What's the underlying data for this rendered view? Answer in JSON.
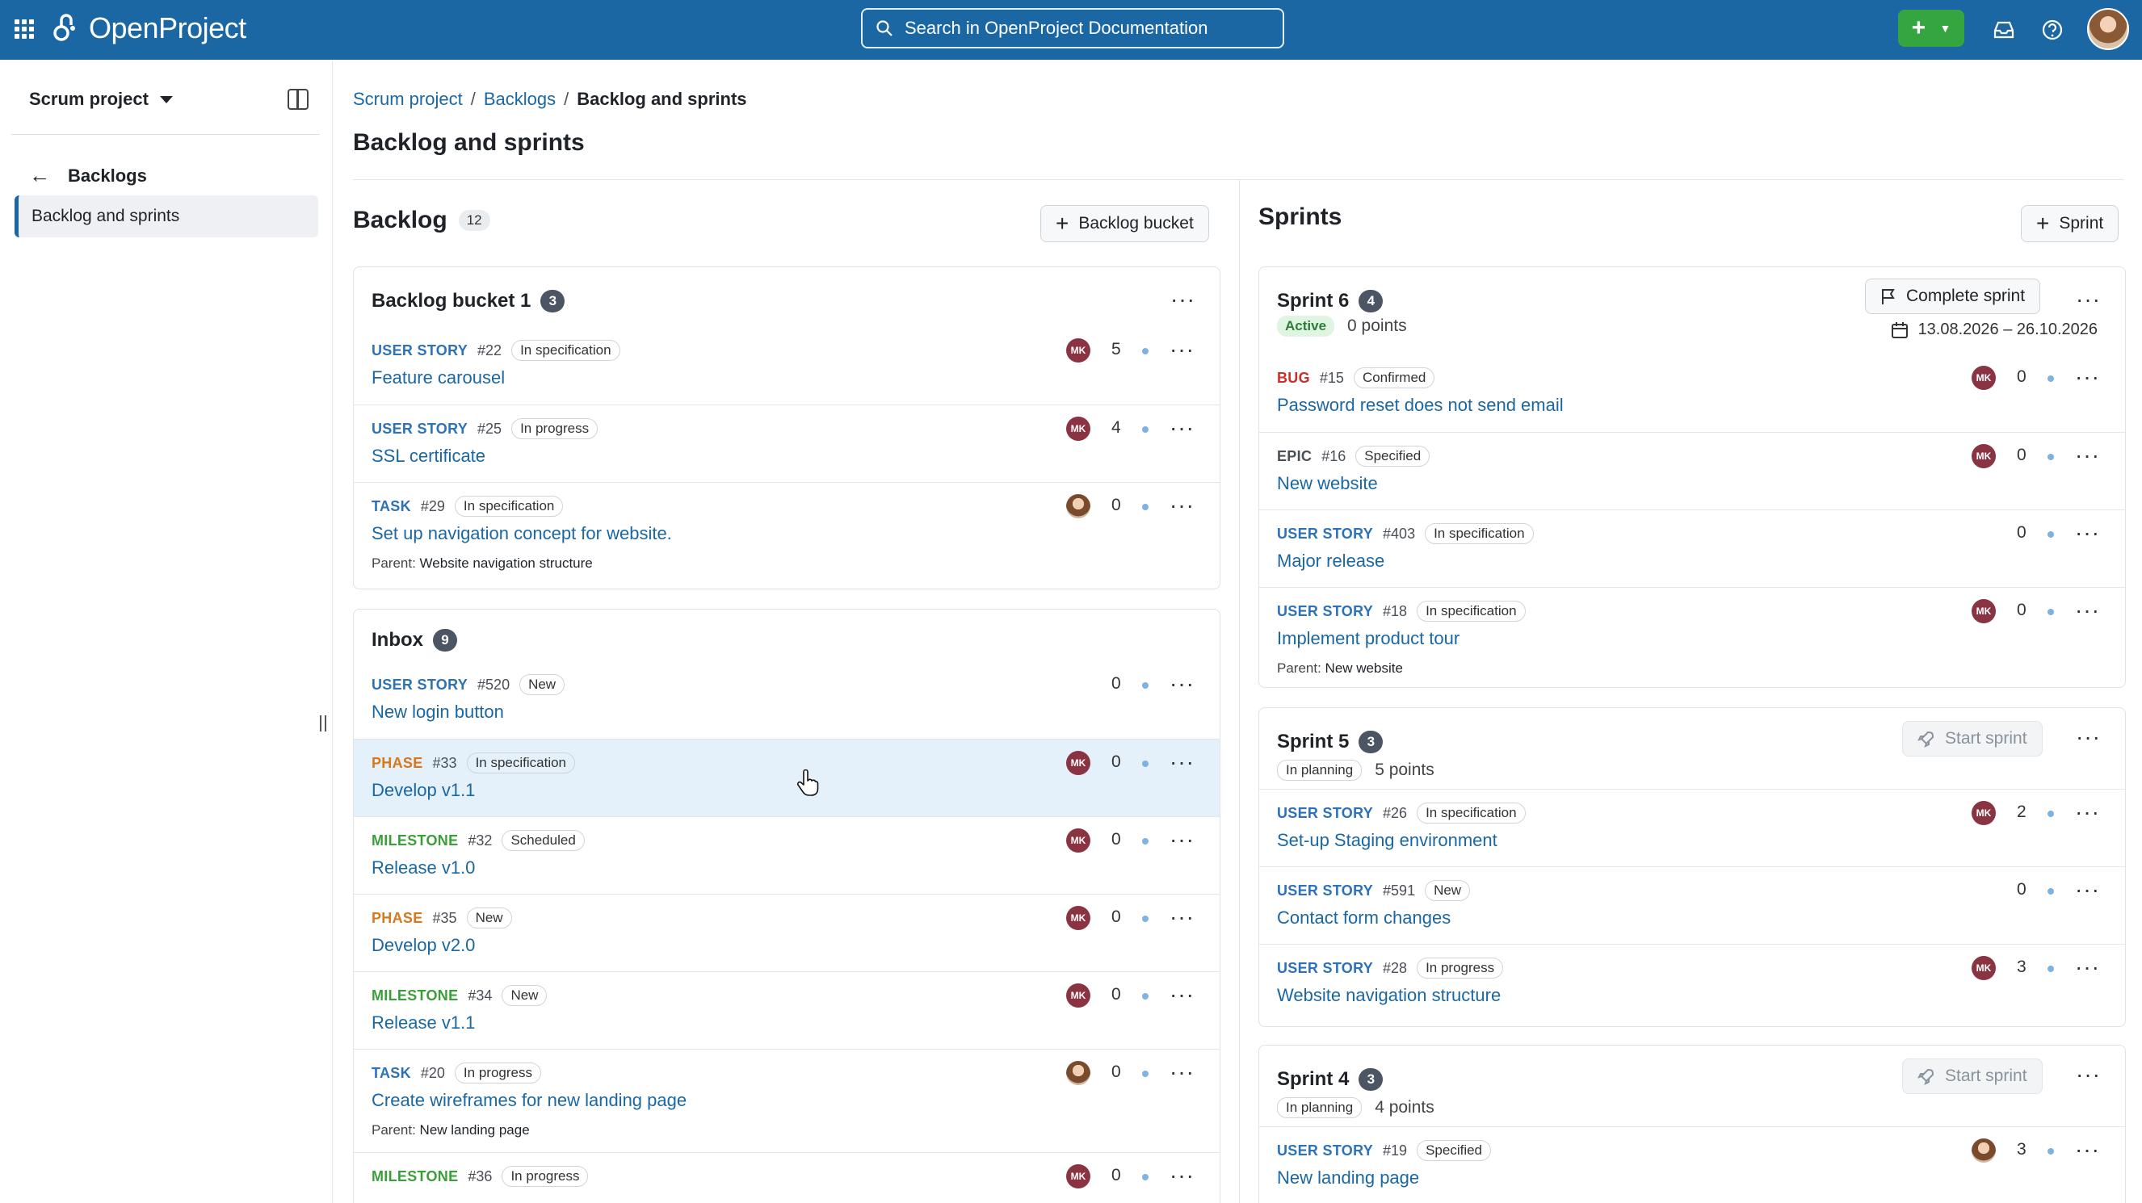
{
  "header": {
    "logo_text": "OpenProject",
    "search_placeholder": "Search in OpenProject Documentation",
    "plus_label": "+",
    "icons": [
      "grid-icon",
      "logo-icon",
      "search-icon",
      "plus-icon",
      "chevron-down-icon",
      "inbox-icon",
      "help-icon",
      "avatar"
    ]
  },
  "sidebar": {
    "project": "Scrum project",
    "back_label": "Backlogs",
    "active_item": "Backlog and sprints"
  },
  "breadcrumb": [
    "Scrum project",
    "Backlogs",
    "Backlog and sprints"
  ],
  "page_title": "Backlog and sprints",
  "backlog": {
    "title": "Backlog",
    "count": "12",
    "add_button": "Backlog bucket",
    "buckets": [
      {
        "title": "Backlog bucket 1",
        "count": "3",
        "items": [
          {
            "type": "USER STORY",
            "id": "#22",
            "status": "In specification",
            "title": "Feature carousel",
            "avatar": "MK",
            "points": "5"
          },
          {
            "type": "USER STORY",
            "id": "#25",
            "status": "In progress",
            "title": "SSL certificate",
            "avatar": "MK",
            "points": "4"
          },
          {
            "type": "TASK",
            "id": "#29",
            "status": "In specification",
            "title": "Set up navigation concept for website.",
            "avatar": "",
            "points": "0",
            "parent_label": "Parent:",
            "parent": "Website navigation structure"
          }
        ]
      },
      {
        "title": "Inbox",
        "count": "9",
        "items": [
          {
            "type": "USER STORY",
            "id": "#520",
            "status": "New",
            "title": "New login button",
            "avatar": "",
            "points": "0"
          },
          {
            "type": "PHASE",
            "id": "#33",
            "status": "In specification",
            "title": "Develop v1.1",
            "avatar": "MK",
            "points": "0"
          },
          {
            "type": "MILESTONE",
            "id": "#32",
            "status": "Scheduled",
            "title": "Release v1.0",
            "avatar": "MK",
            "points": "0"
          },
          {
            "type": "PHASE",
            "id": "#35",
            "status": "New",
            "title": "Develop v2.0",
            "avatar": "MK",
            "points": "0"
          },
          {
            "type": "MILESTONE",
            "id": "#34",
            "status": "New",
            "title": "Release v1.1",
            "avatar": "MK",
            "points": "0"
          },
          {
            "type": "TASK",
            "id": "#20",
            "status": "In progress",
            "title": "Create wireframes for new landing page",
            "avatar": "",
            "points": "0",
            "parent_label": "Parent:",
            "parent": "New landing page"
          },
          {
            "type": "MILESTONE",
            "id": "#36",
            "status": "In progress",
            "title": "",
            "avatar": "MK",
            "points": "0"
          }
        ]
      }
    ]
  },
  "sprints": {
    "title": "Sprints",
    "add_button": "Sprint",
    "list": [
      {
        "title": "Sprint 6",
        "count": "4",
        "state": "Active",
        "points": "0 points",
        "action": "Complete sprint",
        "dates": "13.08.2026 – 26.10.2026",
        "items": [
          {
            "type": "BUG",
            "id": "#15",
            "status": "Confirmed",
            "title": "Password reset does not send email",
            "avatar": "MK",
            "points": "0"
          },
          {
            "type": "EPIC",
            "id": "#16",
            "status": "Specified",
            "title": "New website",
            "avatar": "MK",
            "points": "0"
          },
          {
            "type": "USER STORY",
            "id": "#403",
            "status": "In specification",
            "title": "Major release",
            "avatar": "",
            "points": "0"
          },
          {
            "type": "USER STORY",
            "id": "#18",
            "status": "In specification",
            "title": "Implement product tour",
            "avatar": "MK",
            "points": "0",
            "parent_label": "Parent:",
            "parent": "New website"
          }
        ]
      },
      {
        "title": "Sprint 5",
        "count": "3",
        "state": "In planning",
        "points": "5 points",
        "action": "Start sprint",
        "items": [
          {
            "type": "USER STORY",
            "id": "#26",
            "status": "In specification",
            "title": "Set-up Staging environment",
            "avatar": "MK",
            "points": "2"
          },
          {
            "type": "USER STORY",
            "id": "#591",
            "status": "New",
            "title": "Contact form changes",
            "avatar": "",
            "points": "0"
          },
          {
            "type": "USER STORY",
            "id": "#28",
            "status": "In progress",
            "title": "Website navigation structure",
            "avatar": "MK",
            "points": "3"
          }
        ]
      },
      {
        "title": "Sprint 4",
        "count": "3",
        "state": "In planning",
        "points": "4 points",
        "action": "Start sprint",
        "items": [
          {
            "type": "USER STORY",
            "id": "#19",
            "status": "Specified",
            "title": "New landing page",
            "avatar": "",
            "points": "3"
          }
        ]
      }
    ]
  },
  "colors": {
    "header_bg": "#1a67a3",
    "accent_green": "#35a63f",
    "link": "#1a67a3",
    "highlight_row": "#e4f0fa"
  }
}
